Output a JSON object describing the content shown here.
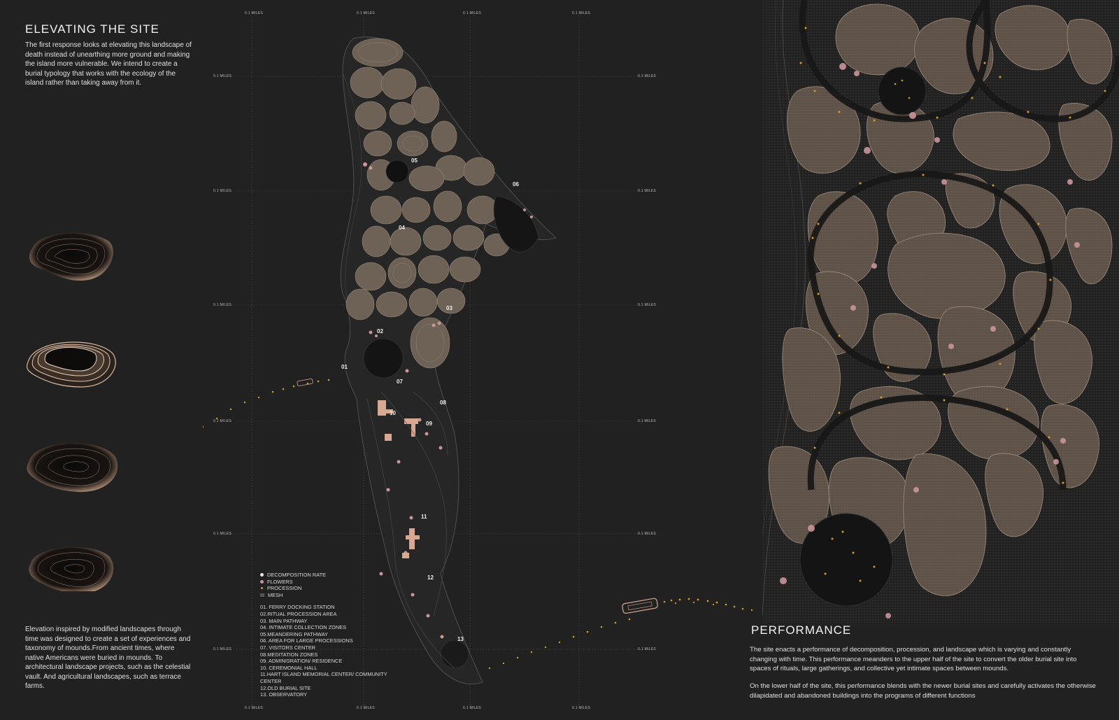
{
  "left": {
    "title": "ELEVATING THE SITE",
    "intro": "The first response looks at elevating this landscape of death instead of unearthing more ground and making the island more vulnerable. We intend to create a burial typology that works with the ecology of the island rather than taking away from it.",
    "bottom": "Elevation inspired by modified landscapes through time was designed to create a set of experiences and taxonomy of mounds.From ancient times, where native Americans were buried in mounds. To architectural landscape projects, such as the celestial vault. And agricultural landscapes, such as terrace farms."
  },
  "grid": {
    "tick_label": "0.1 MILES"
  },
  "map_labels": [
    "01",
    "02",
    "03",
    "04",
    "05",
    "06",
    "07",
    "08",
    "09",
    "10",
    "11",
    "12",
    "13"
  ],
  "legend": {
    "symbols": [
      {
        "label": "DECOMPOSITION RATE",
        "color": "#e8e8e8"
      },
      {
        "label": "FLOWERS",
        "color": "#c9959a"
      },
      {
        "label": "PROCESSION",
        "color": "#d59a2a"
      },
      {
        "label": "MESH",
        "color": "#555555"
      }
    ],
    "items": [
      "01. FERRY DOCKING STATION",
      "02.RITUAL PROCESSION AREA",
      "03. MAIN PATHWAY",
      "04. INTIMATE COLLECTION ZONES",
      "05.MEANDERING PATHWAY",
      "06. AREA FOR LARGE PROCESSIONS",
      "07. VISITORS CENTER",
      "08.MEDITATION ZONES",
      "09. ADMINISRATION/ RESIDENCE",
      "10. CEREMONIAL HALL",
      "11.HART ISLAND MEMORIAL CENTER/ COMMUNITY CENTER",
      "12.OLD BURIAL SITE",
      "13. OBSERVATORY"
    ]
  },
  "right": {
    "title": "PERFORMANCE",
    "para1": "The site enacts a performance of decomposition, procession, and landscape which is varying and constantly changing with time. This performance meanders to the upper half of the site to convert the older burial site into spaces of rituals, large gatherings, and collective yet intimate spaces between mounds.",
    "para2": "On the lower half of the site, this performance blends with the newer burial sites and carefully activates the otherwise dilapidated and abandoned buildings into the programs of different functions"
  },
  "colors": {
    "background": "#212121",
    "mound": "#6e6257",
    "mound_light": "#9a8a7a",
    "procession": "#d59a2a",
    "flower": "#c9959a",
    "building": "#d9a893"
  }
}
